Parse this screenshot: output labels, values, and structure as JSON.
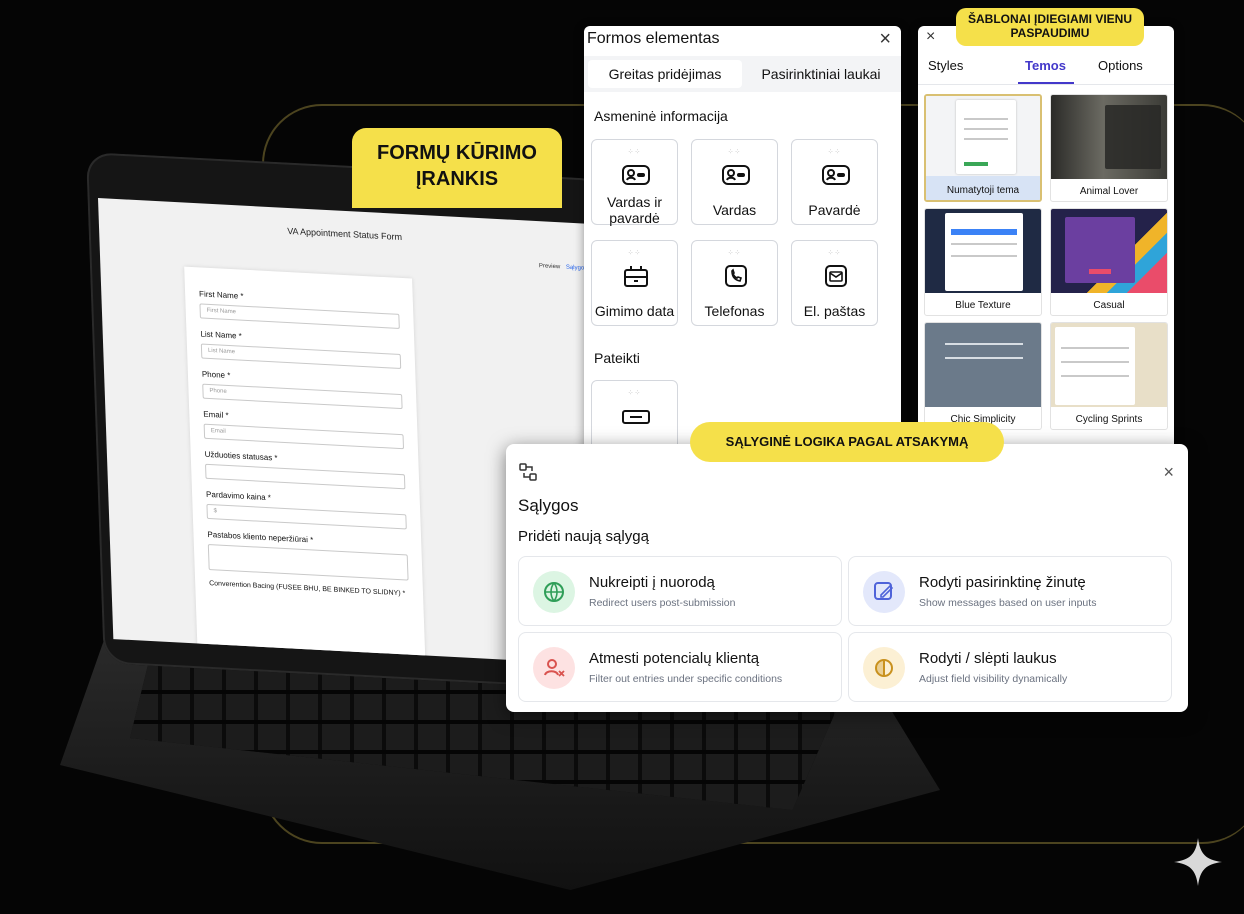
{
  "tags": {
    "builder": "FORMŲ KŪRIMO ĮRANKIS",
    "templates": "ŠABLONAI ĮDIEGIAMI VIENU PASPAUDIMU",
    "logic": "SĄLYGINĖ LOGIKA PAGAL ATSAKYMĄ"
  },
  "laptop_screen": {
    "title": "VA Appointment Status Form",
    "top_links": [
      "Preview",
      "Sąlygos"
    ],
    "fields": [
      {
        "label": "First Name *",
        "placeholder": "First Name"
      },
      {
        "label": "List Name *",
        "placeholder": "List Name"
      },
      {
        "label": "Phone *",
        "placeholder": "Phone"
      },
      {
        "label": "Email *",
        "placeholder": "Email"
      },
      {
        "label": "Užduoties statusas *",
        "placeholder": ""
      },
      {
        "label": "Pardavimo kaina *",
        "placeholder": "$"
      },
      {
        "label": "Pastabos kliento neperžiūrai *",
        "placeholder": ""
      },
      {
        "label": "Converention Bacing (FUSEE BHU, BE BINKED TO SLIDNY) *",
        "placeholder": ""
      }
    ]
  },
  "form_elements": {
    "title": "Formos elementas",
    "close": "×",
    "tabs": [
      "Greitas pridėjimas",
      "Pasirinktiniai laukai"
    ],
    "section_personal": "Asmeninė informacija",
    "tiles": [
      {
        "label": "Vardas ir pavardė",
        "icon": "id-card-icon"
      },
      {
        "label": "Vardas",
        "icon": "id-card-icon"
      },
      {
        "label": "Pavardė",
        "icon": "id-card-icon"
      },
      {
        "label": "Gimimo data",
        "icon": "birthday-cake-icon"
      },
      {
        "label": "Telefonas",
        "icon": "phone-icon"
      },
      {
        "label": "El. paštas",
        "icon": "mail-icon"
      }
    ],
    "section_submit": "Pateikti",
    "submit_tile_icon": "button-icon"
  },
  "templates": {
    "close": "×",
    "tabs": [
      "Styles",
      "Temos",
      "Options"
    ],
    "active_tab": "Temos",
    "items": [
      {
        "name": "Numatytoji tema",
        "selected": true,
        "color": "#f3f4f6"
      },
      {
        "name": "Animal Lover",
        "selected": false,
        "color": "#4a4a44"
      },
      {
        "name": "Blue Texture",
        "selected": false,
        "color": "#1f2a44"
      },
      {
        "name": "Casual",
        "selected": false,
        "color": "#24224a"
      },
      {
        "name": "Chic Simplicity",
        "selected": false,
        "color": "#6b7a8a"
      },
      {
        "name": "Cycling Sprints",
        "selected": false,
        "color": "#e8dfc8"
      }
    ]
  },
  "conditions": {
    "title": "Sąlygos",
    "subtitle": "Pridėti naują sąlygą",
    "close": "×",
    "cards": [
      {
        "title": "Nukreipti į nuorodą",
        "desc": "Redirect users post-submission",
        "icon": "redirect-globe-icon",
        "bg": "#dcf5e3",
        "fg": "#2f9e58"
      },
      {
        "title": "Rodyti pasirinktinę žinutę",
        "desc": "Show messages based on user inputs",
        "icon": "edit-message-icon",
        "bg": "#e3e8fb",
        "fg": "#4f63d9"
      },
      {
        "title": "Atmesti potencialų klientą",
        "desc": "Filter out entries under specific conditions",
        "icon": "user-reject-icon",
        "bg": "#fde2e2",
        "fg": "#d9534f"
      },
      {
        "title": "Rodyti / slėpti laukus",
        "desc": "Adjust field visibility dynamically",
        "icon": "visibility-toggle-icon",
        "bg": "#fcf0d4",
        "fg": "#c9911e"
      }
    ]
  }
}
